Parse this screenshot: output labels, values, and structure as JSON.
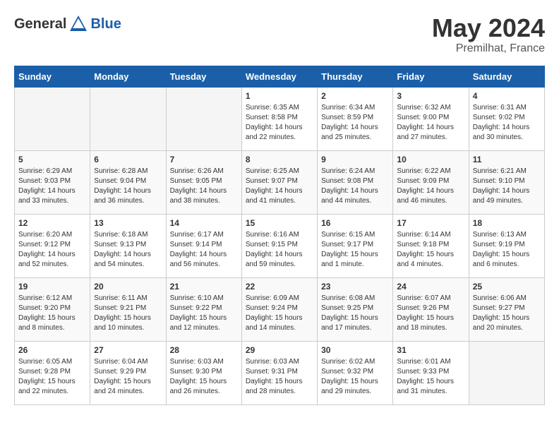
{
  "header": {
    "logo_general": "General",
    "logo_blue": "Blue",
    "month": "May 2024",
    "location": "Premilhat, France"
  },
  "days_of_week": [
    "Sunday",
    "Monday",
    "Tuesday",
    "Wednesday",
    "Thursday",
    "Friday",
    "Saturday"
  ],
  "weeks": [
    [
      {
        "day": "",
        "empty": true
      },
      {
        "day": "",
        "empty": true
      },
      {
        "day": "",
        "empty": true
      },
      {
        "day": "1",
        "sunrise": "Sunrise: 6:35 AM",
        "sunset": "Sunset: 8:58 PM",
        "daylight": "Daylight: 14 hours and 22 minutes."
      },
      {
        "day": "2",
        "sunrise": "Sunrise: 6:34 AM",
        "sunset": "Sunset: 8:59 PM",
        "daylight": "Daylight: 14 hours and 25 minutes."
      },
      {
        "day": "3",
        "sunrise": "Sunrise: 6:32 AM",
        "sunset": "Sunset: 9:00 PM",
        "daylight": "Daylight: 14 hours and 27 minutes."
      },
      {
        "day": "4",
        "sunrise": "Sunrise: 6:31 AM",
        "sunset": "Sunset: 9:02 PM",
        "daylight": "Daylight: 14 hours and 30 minutes."
      }
    ],
    [
      {
        "day": "5",
        "sunrise": "Sunrise: 6:29 AM",
        "sunset": "Sunset: 9:03 PM",
        "daylight": "Daylight: 14 hours and 33 minutes."
      },
      {
        "day": "6",
        "sunrise": "Sunrise: 6:28 AM",
        "sunset": "Sunset: 9:04 PM",
        "daylight": "Daylight: 14 hours and 36 minutes."
      },
      {
        "day": "7",
        "sunrise": "Sunrise: 6:26 AM",
        "sunset": "Sunset: 9:05 PM",
        "daylight": "Daylight: 14 hours and 38 minutes."
      },
      {
        "day": "8",
        "sunrise": "Sunrise: 6:25 AM",
        "sunset": "Sunset: 9:07 PM",
        "daylight": "Daylight: 14 hours and 41 minutes."
      },
      {
        "day": "9",
        "sunrise": "Sunrise: 6:24 AM",
        "sunset": "Sunset: 9:08 PM",
        "daylight": "Daylight: 14 hours and 44 minutes."
      },
      {
        "day": "10",
        "sunrise": "Sunrise: 6:22 AM",
        "sunset": "Sunset: 9:09 PM",
        "daylight": "Daylight: 14 hours and 46 minutes."
      },
      {
        "day": "11",
        "sunrise": "Sunrise: 6:21 AM",
        "sunset": "Sunset: 9:10 PM",
        "daylight": "Daylight: 14 hours and 49 minutes."
      }
    ],
    [
      {
        "day": "12",
        "sunrise": "Sunrise: 6:20 AM",
        "sunset": "Sunset: 9:12 PM",
        "daylight": "Daylight: 14 hours and 52 minutes."
      },
      {
        "day": "13",
        "sunrise": "Sunrise: 6:18 AM",
        "sunset": "Sunset: 9:13 PM",
        "daylight": "Daylight: 14 hours and 54 minutes."
      },
      {
        "day": "14",
        "sunrise": "Sunrise: 6:17 AM",
        "sunset": "Sunset: 9:14 PM",
        "daylight": "Daylight: 14 hours and 56 minutes."
      },
      {
        "day": "15",
        "sunrise": "Sunrise: 6:16 AM",
        "sunset": "Sunset: 9:15 PM",
        "daylight": "Daylight: 14 hours and 59 minutes."
      },
      {
        "day": "16",
        "sunrise": "Sunrise: 6:15 AM",
        "sunset": "Sunset: 9:17 PM",
        "daylight": "Daylight: 15 hours and 1 minute."
      },
      {
        "day": "17",
        "sunrise": "Sunrise: 6:14 AM",
        "sunset": "Sunset: 9:18 PM",
        "daylight": "Daylight: 15 hours and 4 minutes."
      },
      {
        "day": "18",
        "sunrise": "Sunrise: 6:13 AM",
        "sunset": "Sunset: 9:19 PM",
        "daylight": "Daylight: 15 hours and 6 minutes."
      }
    ],
    [
      {
        "day": "19",
        "sunrise": "Sunrise: 6:12 AM",
        "sunset": "Sunset: 9:20 PM",
        "daylight": "Daylight: 15 hours and 8 minutes."
      },
      {
        "day": "20",
        "sunrise": "Sunrise: 6:11 AM",
        "sunset": "Sunset: 9:21 PM",
        "daylight": "Daylight: 15 hours and 10 minutes."
      },
      {
        "day": "21",
        "sunrise": "Sunrise: 6:10 AM",
        "sunset": "Sunset: 9:22 PM",
        "daylight": "Daylight: 15 hours and 12 minutes."
      },
      {
        "day": "22",
        "sunrise": "Sunrise: 6:09 AM",
        "sunset": "Sunset: 9:24 PM",
        "daylight": "Daylight: 15 hours and 14 minutes."
      },
      {
        "day": "23",
        "sunrise": "Sunrise: 6:08 AM",
        "sunset": "Sunset: 9:25 PM",
        "daylight": "Daylight: 15 hours and 17 minutes."
      },
      {
        "day": "24",
        "sunrise": "Sunrise: 6:07 AM",
        "sunset": "Sunset: 9:26 PM",
        "daylight": "Daylight: 15 hours and 18 minutes."
      },
      {
        "day": "25",
        "sunrise": "Sunrise: 6:06 AM",
        "sunset": "Sunset: 9:27 PM",
        "daylight": "Daylight: 15 hours and 20 minutes."
      }
    ],
    [
      {
        "day": "26",
        "sunrise": "Sunrise: 6:05 AM",
        "sunset": "Sunset: 9:28 PM",
        "daylight": "Daylight: 15 hours and 22 minutes."
      },
      {
        "day": "27",
        "sunrise": "Sunrise: 6:04 AM",
        "sunset": "Sunset: 9:29 PM",
        "daylight": "Daylight: 15 hours and 24 minutes."
      },
      {
        "day": "28",
        "sunrise": "Sunrise: 6:03 AM",
        "sunset": "Sunset: 9:30 PM",
        "daylight": "Daylight: 15 hours and 26 minutes."
      },
      {
        "day": "29",
        "sunrise": "Sunrise: 6:03 AM",
        "sunset": "Sunset: 9:31 PM",
        "daylight": "Daylight: 15 hours and 28 minutes."
      },
      {
        "day": "30",
        "sunrise": "Sunrise: 6:02 AM",
        "sunset": "Sunset: 9:32 PM",
        "daylight": "Daylight: 15 hours and 29 minutes."
      },
      {
        "day": "31",
        "sunrise": "Sunrise: 6:01 AM",
        "sunset": "Sunset: 9:33 PM",
        "daylight": "Daylight: 15 hours and 31 minutes."
      },
      {
        "day": "",
        "empty": true
      }
    ]
  ]
}
